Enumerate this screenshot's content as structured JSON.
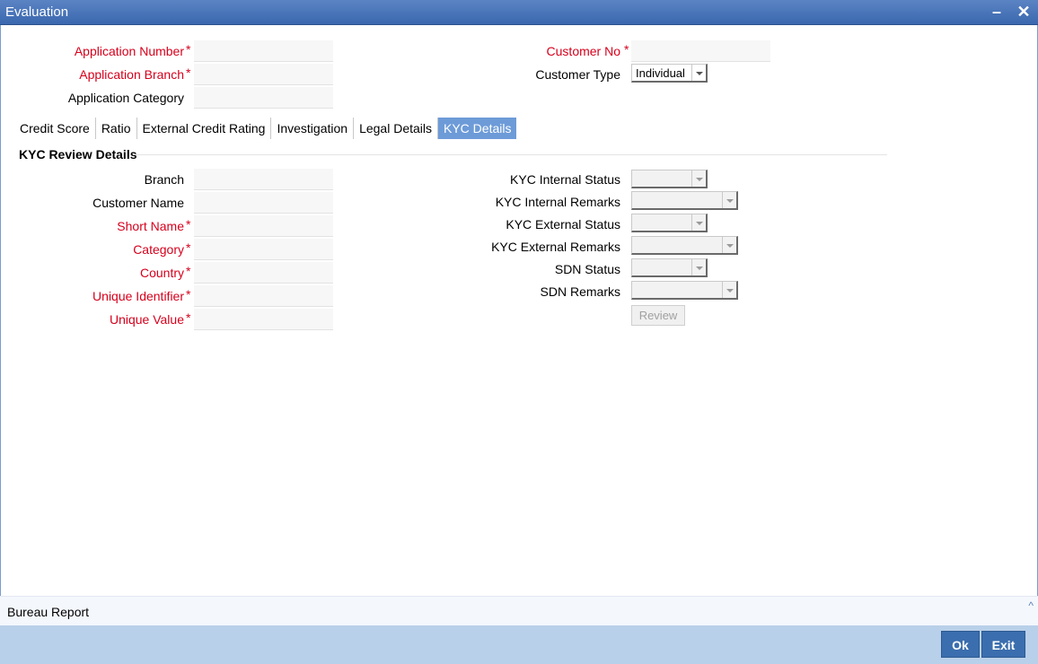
{
  "window": {
    "title": "Evaluation",
    "minimize_symbol": "–",
    "close_symbol": "✕"
  },
  "header": {
    "application_number_label": "Application Number",
    "application_branch_label": "Application Branch",
    "application_category_label": "Application Category",
    "customer_no_label": "Customer No",
    "customer_type_label": "Customer Type",
    "customer_type_value": "Individual",
    "required_marker": "*"
  },
  "tabs": [
    {
      "label": "Credit Score"
    },
    {
      "label": "Ratio"
    },
    {
      "label": "External Credit Rating"
    },
    {
      "label": "Investigation"
    },
    {
      "label": "Legal Details"
    },
    {
      "label": "KYC Details",
      "active": true
    }
  ],
  "kyc": {
    "section_title": "KYC Review Details",
    "branch_label": "Branch",
    "customer_name_label": "Customer Name",
    "short_name_label": "Short Name",
    "category_label": "Category",
    "country_label": "Country",
    "unique_identifier_label": "Unique Identifier",
    "unique_value_label": "Unique Value",
    "kyc_internal_status_label": "KYC Internal Status",
    "kyc_internal_remarks_label": "KYC Internal Remarks",
    "kyc_external_status_label": "KYC External Status",
    "kyc_external_remarks_label": "KYC External Remarks",
    "sdn_status_label": "SDN Status",
    "sdn_remarks_label": "SDN Remarks",
    "review_button": "Review"
  },
  "bureau": {
    "label": "Bureau Report",
    "toggle_symbol": "^"
  },
  "footer": {
    "ok_label": "Ok",
    "exit_label": "Exit"
  },
  "colors": {
    "title_bar": "#3a67ae",
    "required": "#d6001c",
    "active_tab": "#6d9bd8",
    "footer_bar": "#b9d0ea",
    "footer_button": "#3b6eae"
  }
}
